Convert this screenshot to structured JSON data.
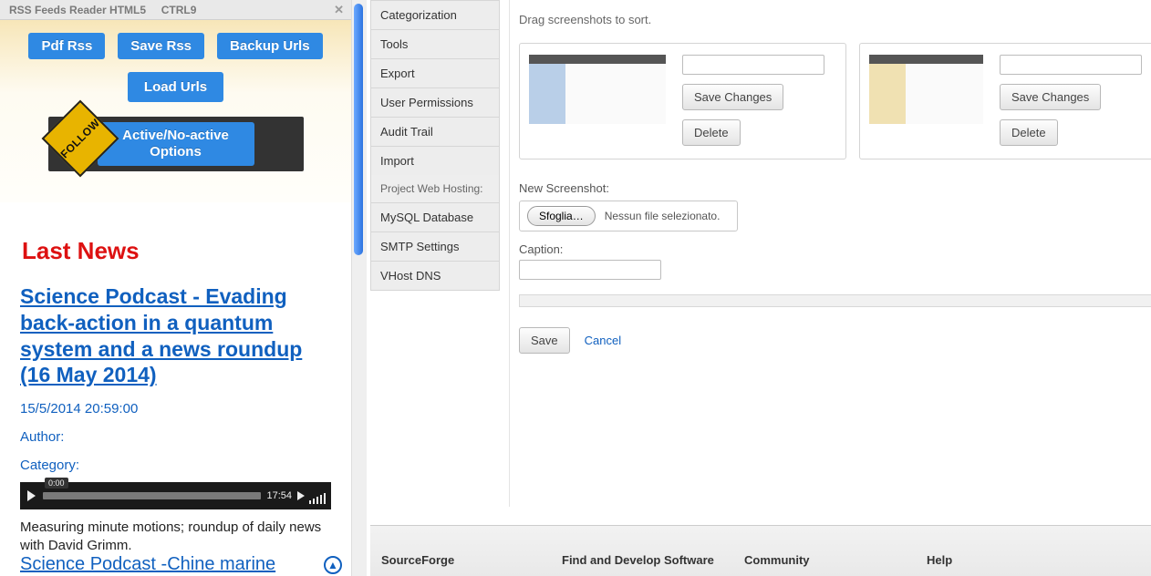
{
  "left": {
    "title": "RSS Feeds Reader HTML5",
    "shortcut": "CTRL9",
    "buttons": {
      "pdf": "Pdf Rss",
      "save": "Save Rss",
      "backup": "Backup Urls",
      "load": "Load Urls",
      "options": "Active/No-active Options"
    },
    "follow": "FOLLOW",
    "news": {
      "heading": "Last News",
      "title": "Science Podcast - Evading back-action in a quantum system and a news roundup (16 May 2014)",
      "datetime": "15/5/2014 20:59:00",
      "author_label": "Author:",
      "category_label": "Category:",
      "audio": {
        "pos": "0:00",
        "dur": "17:54"
      },
      "desc": "Measuring minute motions; roundup of daily news with David Grimm.",
      "more": "Science Podcast -Chine marine"
    }
  },
  "nav": {
    "items1": [
      "Categorization",
      "Tools",
      "Export",
      "User Permissions",
      "Audit Trail",
      "Import"
    ],
    "group2_label": "Project Web Hosting:",
    "items2": [
      "MySQL Database",
      "SMTP Settings",
      "VHost DNS"
    ]
  },
  "main": {
    "hint": "Drag screenshots to sort.",
    "save_changes": "Save Changes",
    "delete": "Delete",
    "new_label": "New Screenshot:",
    "browse": "Sfoglia…",
    "nofile": "Nessun file selezionato.",
    "caption_label": "Caption:",
    "save": "Save",
    "cancel": "Cancel"
  },
  "footer": {
    "c1": "SourceForge",
    "c2": "Find and Develop Software",
    "c3": "Community",
    "c4": "Help"
  }
}
